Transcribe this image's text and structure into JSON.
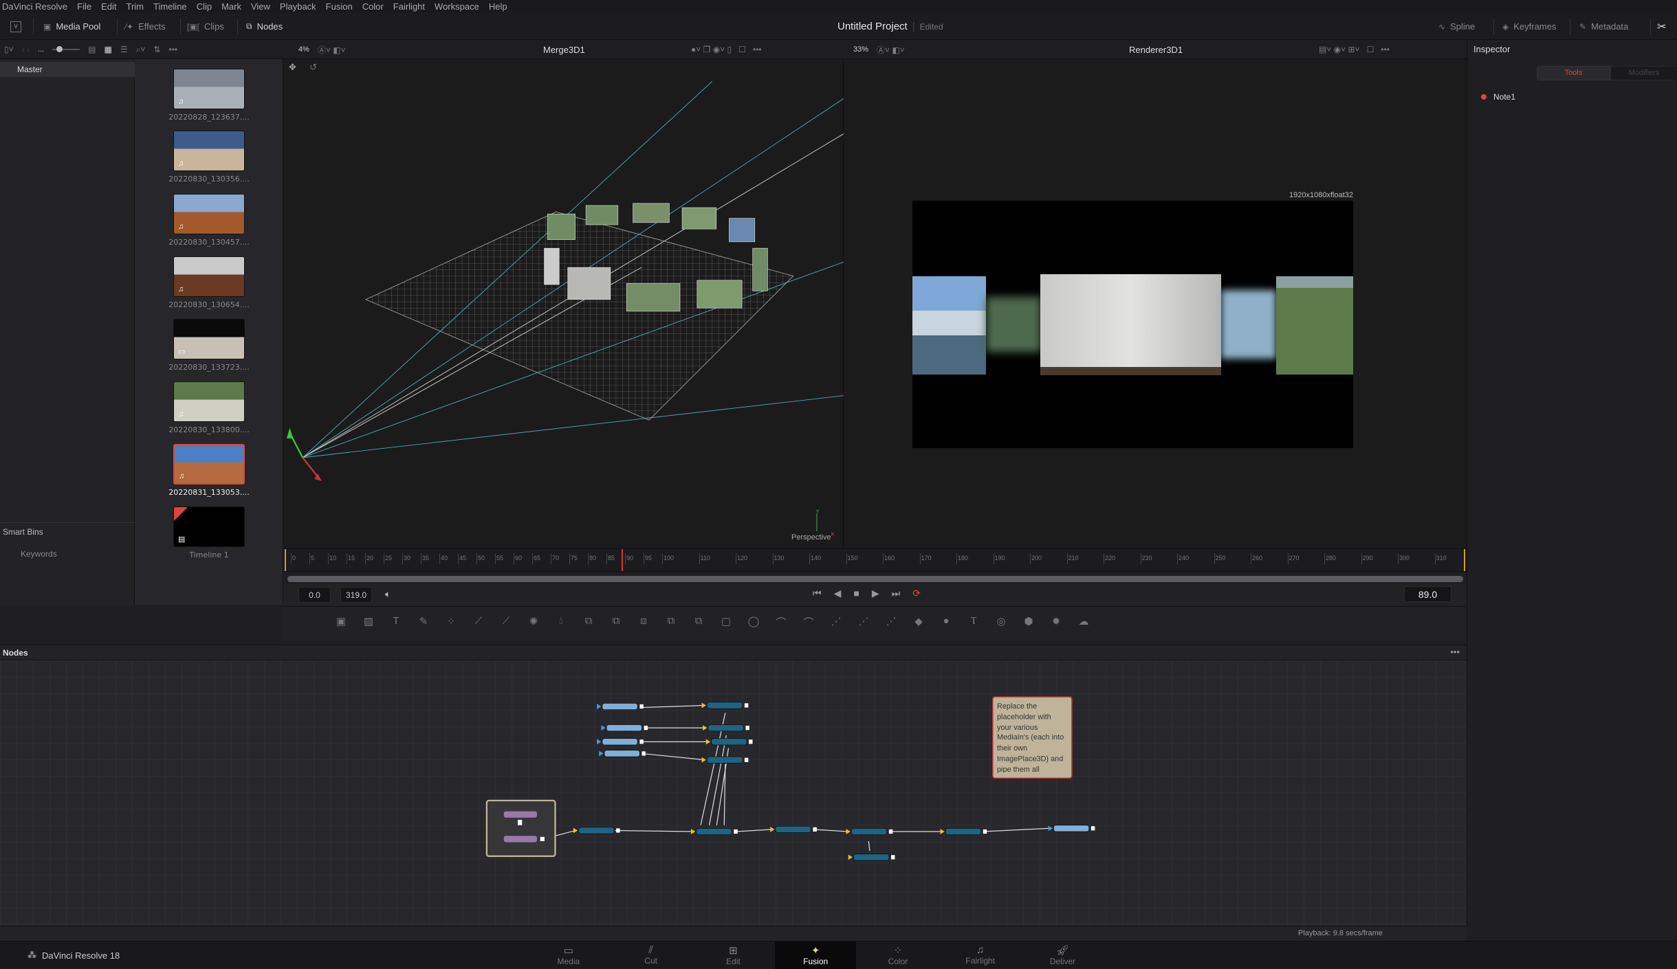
{
  "menu": [
    "DaVinci Resolve",
    "File",
    "Edit",
    "Trim",
    "Timeline",
    "Clip",
    "Mark",
    "View",
    "Playback",
    "Fusion",
    "Color",
    "Fairlight",
    "Workspace",
    "Help"
  ],
  "toolbar": {
    "media_pool": "Media Pool",
    "effects": "Effects",
    "clips": "Clips",
    "nodes": "Nodes",
    "project_title": "Untitled Project",
    "project_status": "Edited",
    "spline": "Spline",
    "keyframes": "Keyframes",
    "metadata": "Metadata"
  },
  "pool_header": {
    "ellipsis": "..."
  },
  "viewer_left": {
    "zoom": "4%",
    "title": "Merge3D1",
    "camera_label": "Perspective",
    "axis_y": "Y",
    "axis_x": "X"
  },
  "viewer_right": {
    "zoom": "33%",
    "title": "Renderer3D1",
    "resolution": "1920x1080xfloat32"
  },
  "inspector": {
    "title": "Inspector",
    "tabs": [
      "Tools",
      "Modifiers"
    ],
    "active_tab": "Tools",
    "items": [
      {
        "name": "Note1",
        "color": "#e0453a"
      }
    ]
  },
  "sidebar": {
    "master": "Master",
    "smart_bins": "Smart Bins",
    "keywords": "Keywords"
  },
  "media_pool": [
    {
      "name": "20220828_123637....",
      "type": "audio-video",
      "colors": [
        "#7d8590",
        "#aab0b8"
      ]
    },
    {
      "name": "20220830_130356....",
      "type": "audio-video",
      "colors": [
        "#3d5c8c",
        "#c9b59a"
      ]
    },
    {
      "name": "20220830_130457....",
      "type": "audio-video",
      "colors": [
        "#8aa8d0",
        "#a35a2a"
      ]
    },
    {
      "name": "20220830_130654....",
      "type": "audio-video",
      "colors": [
        "#c9c9c9",
        "#6a3a22"
      ]
    },
    {
      "name": "20220830_133723....",
      "type": "video",
      "colors": [
        "#0a0a0a",
        "#c8c0b4"
      ]
    },
    {
      "name": "20220830_133800....",
      "type": "audio-video",
      "colors": [
        "#5c7a4a",
        "#cfcfc4"
      ]
    },
    {
      "name": "20220831_133053....",
      "type": "audio-video",
      "colors": [
        "#4d7fc4",
        "#b56a40"
      ],
      "selected": true
    },
    {
      "name": "Timeline 1",
      "type": "timeline",
      "colors": [
        "#000000",
        "#000000"
      ]
    }
  ],
  "ruler": {
    "labels": [
      "0",
      "5",
      "10",
      "15",
      "20",
      "25",
      "30",
      "35",
      "40",
      "45",
      "50",
      "55",
      "60",
      "65",
      "70",
      "75",
      "80",
      "85",
      "90",
      "95",
      "100",
      "110",
      "120",
      "130",
      "140",
      "150",
      "160",
      "170",
      "180",
      "190",
      "200",
      "210",
      "220",
      "230",
      "240",
      "250",
      "260",
      "270",
      "280",
      "290",
      "300",
      "310"
    ],
    "playhead": 89
  },
  "transport": {
    "start": "0.0",
    "end": "319.0",
    "current": "89.0"
  },
  "nodes": {
    "title": "Nodes",
    "note_text": "Replace the placeholder with your various MediaIn's (each into their own ImagePlace3D) and pipe them all"
  },
  "status": {
    "playback": "Playback: 9.8 secs/frame"
  },
  "app": {
    "name": "DaVinci Resolve 18"
  },
  "pages": [
    {
      "label": "Media",
      "icon": "media-icon"
    },
    {
      "label": "Cut",
      "icon": "cut-icon"
    },
    {
      "label": "Edit",
      "icon": "edit-icon"
    },
    {
      "label": "Fusion",
      "icon": "fusion-icon",
      "active": true
    },
    {
      "label": "Color",
      "icon": "color-icon"
    },
    {
      "label": "Fairlight",
      "icon": "fairlight-icon"
    },
    {
      "label": "Deliver",
      "icon": "deliver-icon"
    }
  ],
  "colors": {
    "accent_red": "#e0453a",
    "node_dark": "#1e6485",
    "node_light": "#7fb0db",
    "group": "#9a78aa",
    "note_bg": "#bfb49a"
  }
}
